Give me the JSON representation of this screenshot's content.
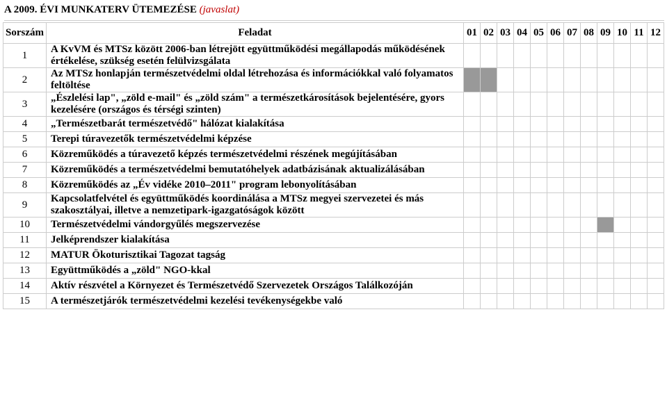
{
  "title_prefix": "A 2009. ÉVI MUNKATERV ÜTEMEZÉSE ",
  "title_suffix": "(javaslat)",
  "headers": {
    "sorszam": "Sorszám",
    "feladat": "Feladat",
    "months": [
      "01",
      "02",
      "03",
      "04",
      "05",
      "06",
      "07",
      "08",
      "09",
      "10",
      "11",
      "12"
    ]
  },
  "rows": [
    {
      "n": "1",
      "text": "A KvVM és MTSz között 2006-ban létrejött együttműködési megállapodás működésének értékelése, szükség esetén felülvizsgálata",
      "months": []
    },
    {
      "n": "2",
      "text": "Az MTSz honlapján természetvédelmi oldal létrehozása és információkkal való folyamatos feltöltése",
      "months": [
        1,
        2
      ]
    },
    {
      "n": "3",
      "text": "„Észlelési lap\", „zöld e-mail\" és „zöld szám\" a természetkárosítások bejelentésére, gyors kezelésére (országos és térségi szinten)",
      "months": []
    },
    {
      "n": "4",
      "text": "„Természetbarát természetvédő\" hálózat kialakítása",
      "months": []
    },
    {
      "n": "5",
      "text": "Terepi túravezetők természetvédelmi képzése",
      "months": []
    },
    {
      "n": "6",
      "text": "Közreműködés a túravezető képzés természetvédelmi részének megújításában",
      "months": []
    },
    {
      "n": "7",
      "text": "Közreműködés a természetvédelmi bemutatóhelyek adatbázisának aktualizálásában",
      "months": []
    },
    {
      "n": "8",
      "text": "Közreműködés az „Év vidéke 2010–2011\" program lebonyolításában",
      "months": []
    },
    {
      "n": "9",
      "text": "Kapcsolatfelvétel és együttműködés koordinálása a MTSz megyei szervezetei és más szakosztályai, illetve a nemzetipark-igazgatóságok között",
      "months": []
    },
    {
      "n": "10",
      "text": "Természetvédelmi vándorgyűlés megszervezése",
      "months": [
        9
      ]
    },
    {
      "n": "11",
      "text": "Jelképrendszer kialakítása",
      "months": []
    },
    {
      "n": "12",
      "text": "MATUR Ökoturisztikai Tagozat tagság",
      "months": []
    },
    {
      "n": "13",
      "text": "Együttműködés a „zöld\" NGO-kkal",
      "months": []
    },
    {
      "n": "14",
      "text": "Aktív részvétel a Környezet és Természetvédő Szervezetek Országos Találkozóján",
      "months": []
    },
    {
      "n": "15",
      "text": "A természetjárók természetvédelmi kezelési tevékenységekbe való",
      "months": []
    }
  ]
}
